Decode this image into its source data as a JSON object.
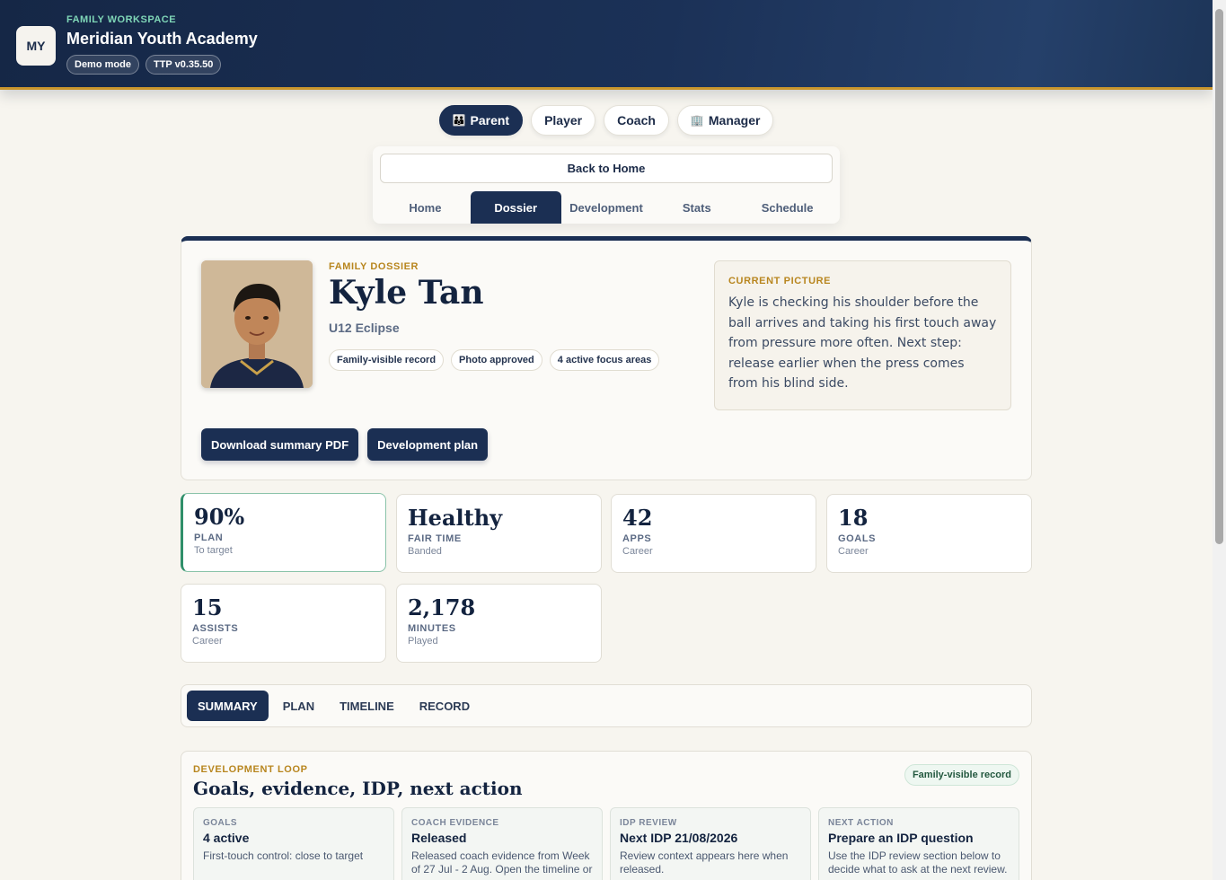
{
  "header": {
    "logo_initials": "MY",
    "workspace_label": "FAMILY WORKSPACE",
    "title": "Meridian Youth Academy",
    "badges": [
      "Demo mode",
      "TTP v0.35.50"
    ]
  },
  "roles": [
    {
      "label": "Parent",
      "icon": "family-icon",
      "glyph": "👪",
      "active": true
    },
    {
      "label": "Player",
      "active": false
    },
    {
      "label": "Coach",
      "active": false
    },
    {
      "label": "Manager",
      "icon": "building-icon",
      "glyph": "🏢",
      "active": false
    }
  ],
  "subnav": {
    "back_label": "Back to Home",
    "tabs": [
      "Home",
      "Dossier",
      "Development",
      "Stats",
      "Schedule"
    ],
    "active_tab": "Dossier"
  },
  "dossier": {
    "eyebrow": "FAMILY DOSSIER",
    "name": "Kyle Tan",
    "team": "U12 Eclipse",
    "chips": [
      "Family-visible record",
      "Photo approved",
      "4 active focus areas"
    ],
    "current_picture": {
      "label": "CURRENT PICTURE",
      "text": "Kyle is checking his shoulder before the ball arrives and taking his first touch away from pressure more often. Next step: release earlier when the press comes from his blind side."
    },
    "actions": [
      "Download summary PDF",
      "Development plan"
    ]
  },
  "stats": [
    {
      "value": "90%",
      "label": "PLAN",
      "sub": "To target",
      "highlight": true
    },
    {
      "value": "Healthy",
      "label": "FAIR TIME",
      "sub": "Banded"
    },
    {
      "value": "42",
      "label": "APPS",
      "sub": "Career"
    },
    {
      "value": "18",
      "label": "GOALS",
      "sub": "Career"
    },
    {
      "value": "15",
      "label": "ASSISTS",
      "sub": "Career"
    },
    {
      "value": "2,178",
      "label": "MINUTES",
      "sub": "Played"
    }
  ],
  "section_tabs": [
    "SUMMARY",
    "PLAN",
    "TIMELINE",
    "RECORD"
  ],
  "loop": {
    "eyebrow": "DEVELOPMENT LOOP",
    "title": "Goals, evidence, IDP, next action",
    "badge": "Family-visible record",
    "cards": [
      {
        "label": "GOALS",
        "value": "4 active",
        "text": "First-touch control: close to target"
      },
      {
        "label": "COACH EVIDENCE",
        "value": "Released",
        "text": "Released coach evidence from Week of 27 Jul - 2 Aug. Open the timeline or"
      },
      {
        "label": "IDP REVIEW",
        "value": "Next IDP 21/08/2026",
        "text": "Review context appears here when released."
      },
      {
        "label": "NEXT ACTION",
        "value": "Prepare an IDP question",
        "text": "Use the IDP review section below to decide what to ask at the next review."
      }
    ]
  },
  "colors": {
    "navy": "#1b2f53",
    "gold": "#c9962d",
    "mint": "#7fd6b7",
    "green": "#2f8f6a"
  }
}
